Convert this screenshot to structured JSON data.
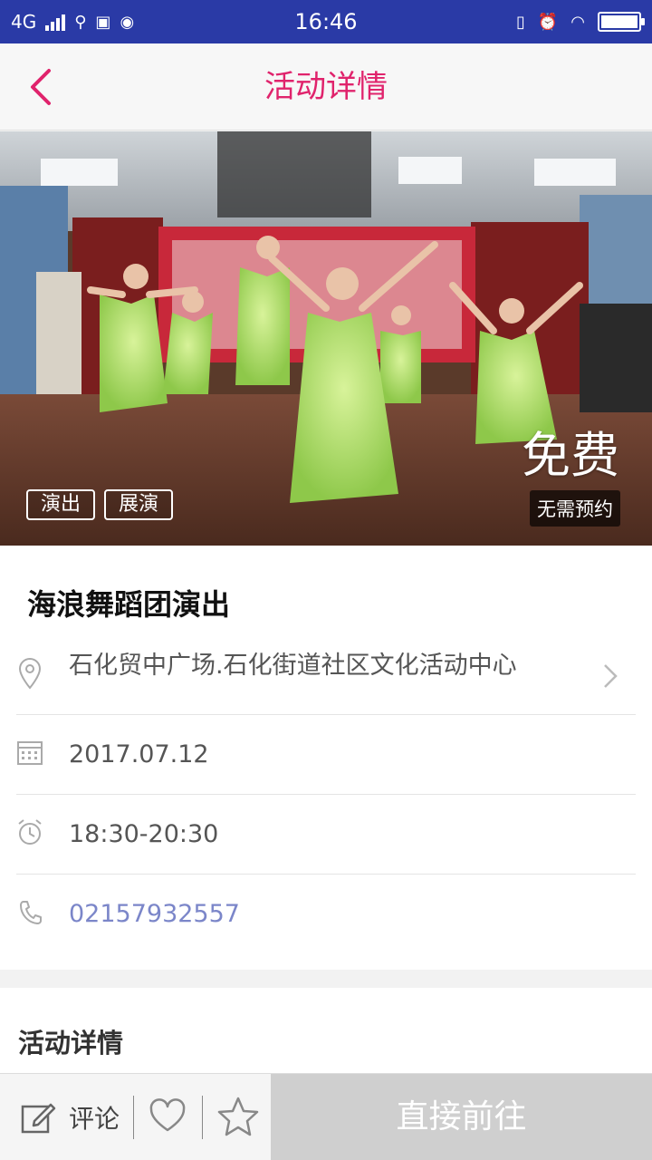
{
  "status_bar": {
    "network": "4G",
    "time": "16:46"
  },
  "header": {
    "title": "活动详情"
  },
  "banner": {
    "tags": [
      "演出",
      "展演"
    ],
    "price": "免费",
    "booking": "无需预约"
  },
  "event": {
    "name": "海浪舞蹈团演出",
    "location": "石化贸中广场.石化街道社区文化活动中心",
    "date": "2017.07.12",
    "time": "18:30-20:30",
    "phone": "02157932557"
  },
  "details": {
    "title": "活动详情"
  },
  "bottom_bar": {
    "comment_label": "评论",
    "go_button": "直接前往"
  },
  "colors": {
    "status_bar": "#2a3aa6",
    "accent": "#e0236c",
    "phone": "#7b86c9",
    "button_disabled": "#cfcfcf"
  }
}
